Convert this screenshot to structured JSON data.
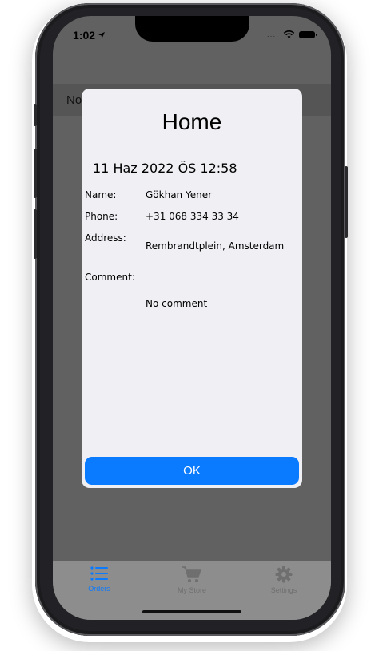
{
  "status_bar": {
    "time": "1:02",
    "signal_dots": "...."
  },
  "nav": {
    "title": "No"
  },
  "dialog": {
    "title": "Home",
    "datetime": "11 Haz 2022 ÖS 12:58",
    "fields": {
      "name_label": "Name:",
      "name_value": "Gökhan Yener",
      "phone_label": "Phone:",
      "phone_value": "+31 068 334 33 34",
      "address_label": "Address:",
      "address_value": "Rembrandtplein, Amsterdam",
      "comment_label": "Comment:",
      "comment_value": "No comment"
    },
    "ok_label": "OK"
  },
  "tabbar": {
    "items": [
      {
        "label": "Orders",
        "icon": "list-icon",
        "active": true
      },
      {
        "label": "My Store",
        "icon": "cart-icon",
        "active": false
      },
      {
        "label": "Settings",
        "icon": "gear-icon",
        "active": false
      }
    ]
  },
  "colors": {
    "accent": "#0a7aff",
    "tab_inactive": "#6f6f6f",
    "dim_overlay": "#616161",
    "dialog_bg": "#efeff4"
  }
}
